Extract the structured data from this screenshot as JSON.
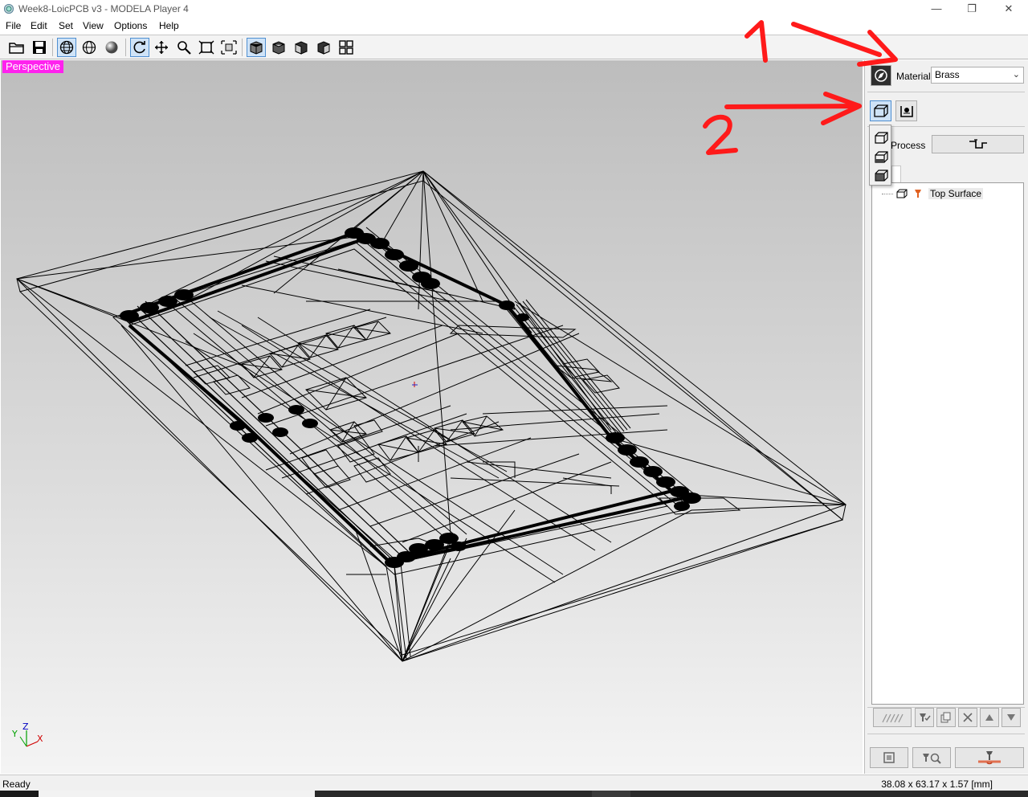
{
  "window": {
    "title": "Week8-LoicPCB v3 - MODELA Player 4",
    "minimize_glyph": "—",
    "restore_glyph": "❐",
    "close_glyph": "✕"
  },
  "menu": [
    "File",
    "Edit",
    "Set",
    "View",
    "Options",
    "Help"
  ],
  "toolbar": {
    "buttons": [
      "open-folder-icon",
      "save-icon",
      "wireframe-view-icon",
      "wire-sphere-icon",
      "solid-sphere-icon",
      "rotate-icon",
      "pan-icon",
      "zoom-icon",
      "fit-view-icon",
      "zoom-box-icon",
      "front-view-icon",
      "iso-view-1-icon",
      "iso-view-2-icon",
      "iso-view-3-icon",
      "multi-view-icon"
    ],
    "active": [
      "wireframe-view-icon",
      "rotate-icon",
      "front-view-icon"
    ]
  },
  "viewport": {
    "label": "Perspective",
    "axis": {
      "y": "Y",
      "z": "Z",
      "x": "X"
    }
  },
  "panel": {
    "material_label": "Material",
    "material_value": "Brass",
    "process_label": "Process",
    "tree_item": "Top Surface"
  },
  "annotations": {
    "one": "1",
    "two": "2",
    "color": "#ff1a1a"
  },
  "status": {
    "left": "Ready",
    "dimensions": "38.08 x 63.17 x 1.57 [mm]"
  }
}
